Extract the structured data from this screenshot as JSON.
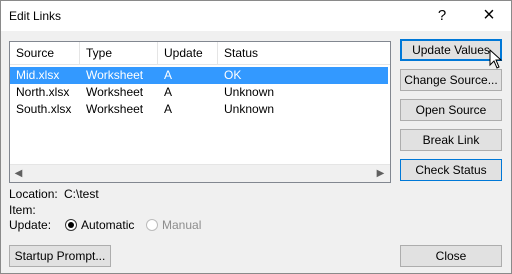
{
  "window": {
    "title": "Edit Links",
    "help_glyph": "?",
    "close_glyph": "×"
  },
  "list": {
    "headers": [
      "Source",
      "Type",
      "Update",
      "Status"
    ],
    "rows": [
      {
        "source": "Mid.xlsx",
        "type": "Worksheet",
        "update": "A",
        "status": "OK",
        "selected": true
      },
      {
        "source": "North.xlsx",
        "type": "Worksheet",
        "update": "A",
        "status": "Unknown",
        "selected": false
      },
      {
        "source": "South.xlsx",
        "type": "Worksheet",
        "update": "A",
        "status": "Unknown",
        "selected": false
      }
    ]
  },
  "buttons": {
    "update_values": "Update Values",
    "change_source": "Change Source...",
    "open_source": "Open Source",
    "break_link": "Break Link",
    "check_status": "Check Status",
    "startup_prompt": "Startup Prompt...",
    "close": "Close"
  },
  "info": {
    "location_label": "Location:",
    "location_value": "C:\\test",
    "item_label": "Item:",
    "item_value": "",
    "update_label": "Update:",
    "automatic_label": "Automatic",
    "manual_label": "Manual",
    "selected_mode": "Automatic"
  },
  "colors": {
    "selection": "#3399ff",
    "focus_border": "#0078d7",
    "dialog_bg": "#f0f0f0"
  }
}
